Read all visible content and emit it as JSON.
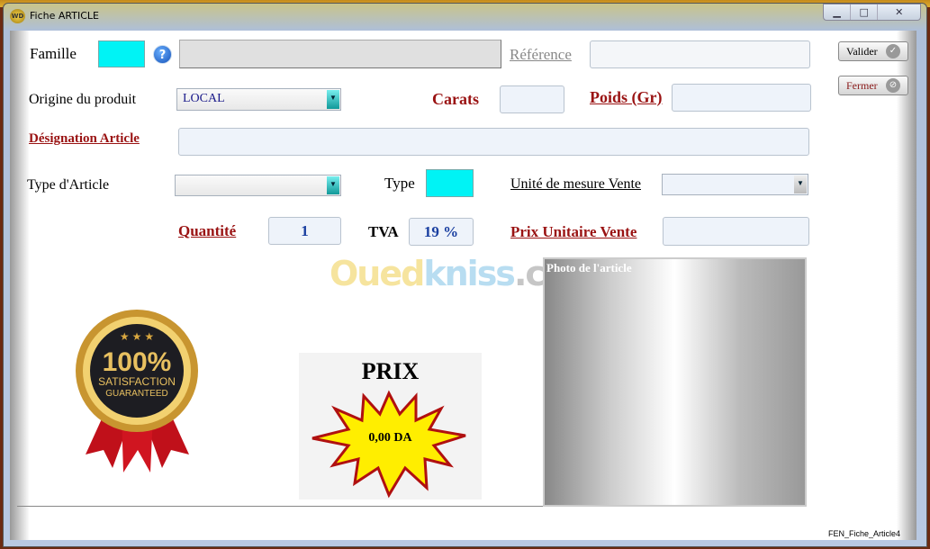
{
  "window": {
    "title": "Fiche ARTICLE",
    "app_icon": "windev-icon",
    "controls": [
      "minimize",
      "maximize",
      "close"
    ]
  },
  "form": {
    "famille": {
      "label": "Famille",
      "value": "",
      "description": ""
    },
    "reference": {
      "label": "Référence",
      "value": ""
    },
    "origine": {
      "label": "Origine du produit",
      "value": "LOCAL"
    },
    "carats": {
      "label": "Carats",
      "value": ""
    },
    "poids": {
      "label": "Poids (Gr)",
      "value": ""
    },
    "designation": {
      "label": "Désignation Article",
      "value": ""
    },
    "type_article": {
      "label": "Type d'Article",
      "value": ""
    },
    "type": {
      "label": "Type",
      "value": ""
    },
    "unite": {
      "label": "Unité de mesure Vente",
      "value": ""
    },
    "quantite": {
      "label": "Quantité",
      "value": "1"
    },
    "tva": {
      "label": "TVA",
      "value": "19 %"
    },
    "prix_unitaire": {
      "label": "Prix Unitaire Vente",
      "value": ""
    }
  },
  "buttons": {
    "valider": "Valider",
    "fermer": "Fermer"
  },
  "badge": {
    "line1": "100%",
    "line2": "SATISFACTION",
    "line3": "GUARANTEED"
  },
  "prix": {
    "title": "PRIX",
    "value": "0,00 DA"
  },
  "photo": {
    "label": "Photo de l'article"
  },
  "watermark": "Ouedkniss.com",
  "footer": {
    "window_name": "FEN_Fiche_Article4"
  }
}
